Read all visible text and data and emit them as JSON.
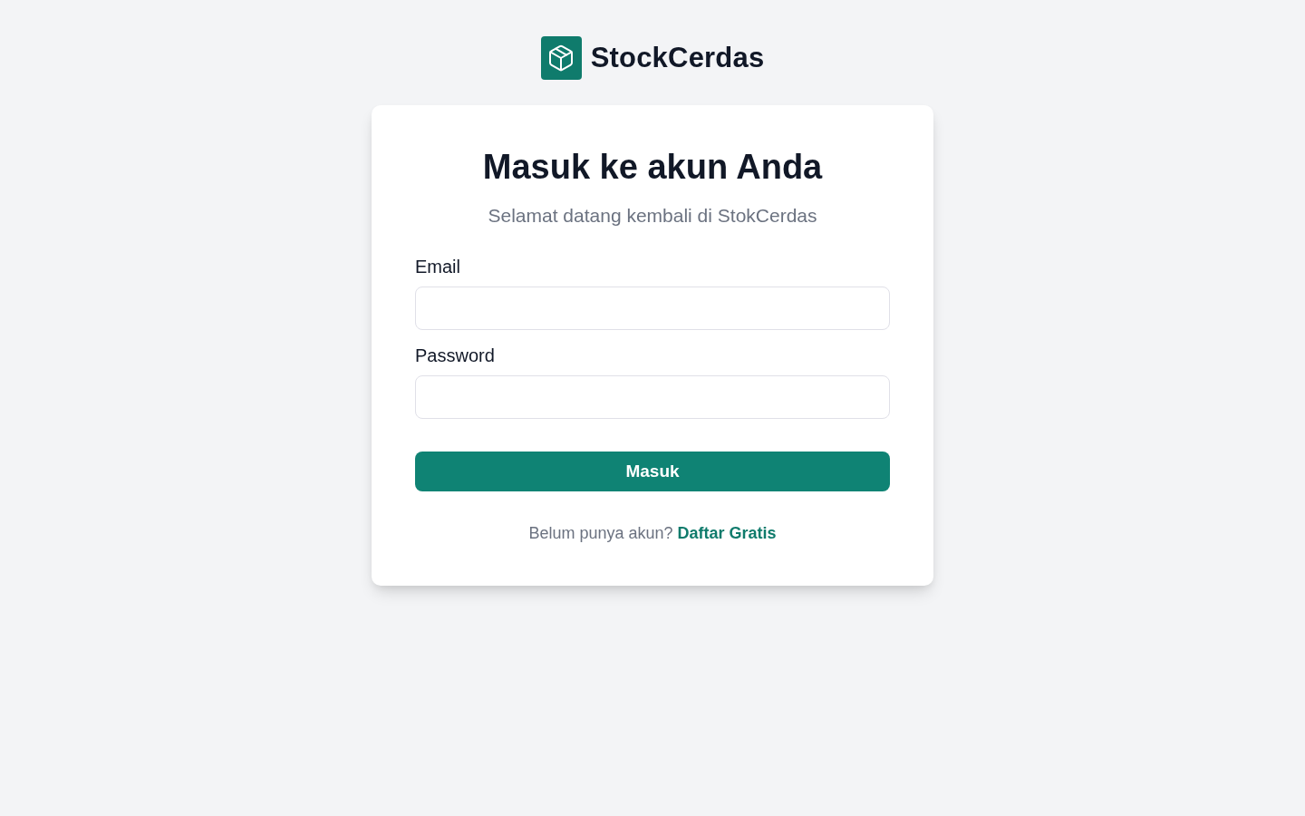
{
  "brand": {
    "name": "StockCerdas"
  },
  "card": {
    "title": "Masuk ke akun Anda",
    "subtitle": "Selamat datang kembali di StokCerdas",
    "fields": [
      {
        "label": "Email"
      },
      {
        "label": "Password"
      }
    ],
    "submit_button": "Masuk",
    "footer": {
      "prompt": "Belum punya akun?",
      "link": "Daftar Gratis"
    }
  }
}
